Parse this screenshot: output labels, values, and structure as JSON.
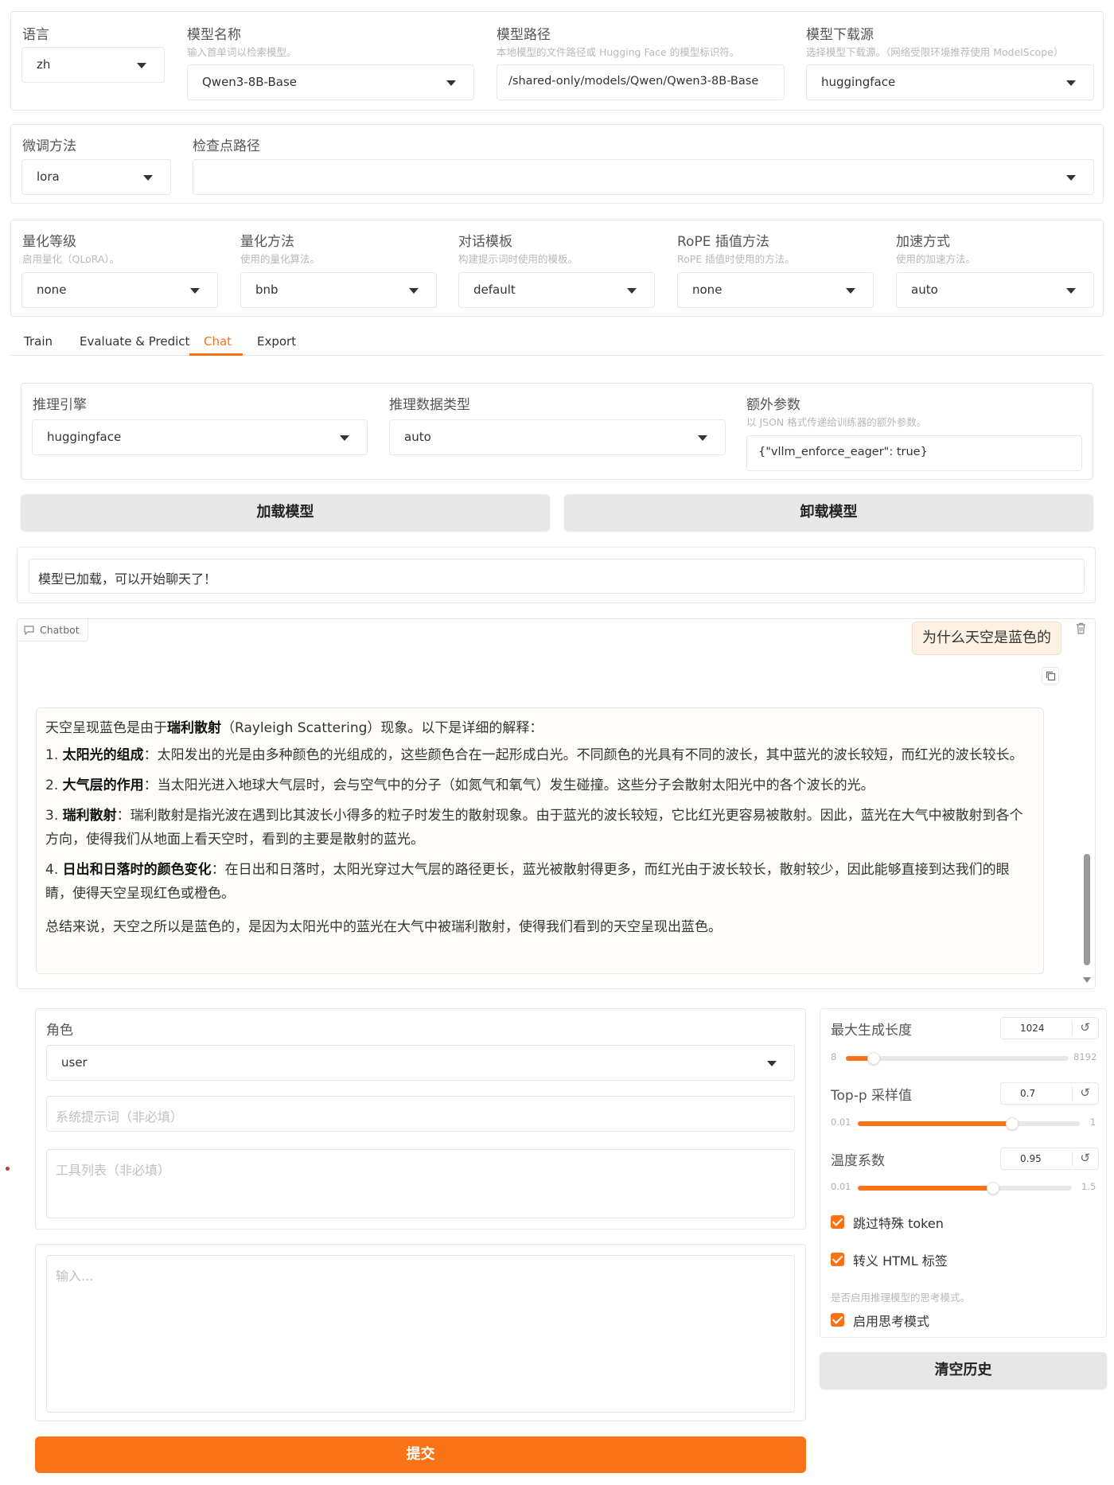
{
  "top": {
    "language": {
      "label": "语言",
      "value": "zh"
    },
    "model_name": {
      "label": "模型名称",
      "hint": "输入首单词以检索模型。",
      "value": "Qwen3-8B-Base"
    },
    "model_path": {
      "label": "模型路径",
      "hint": "本地模型的文件路径或 Hugging Face 的模型标识符。",
      "value": "/shared-only/models/Qwen/Qwen3-8B-Base"
    },
    "model_source": {
      "label": "模型下载源",
      "hint": "选择模型下载源。（网络受限环境推荐使用 ModelScope）",
      "value": "huggingface"
    }
  },
  "finetune": {
    "method": {
      "label": "微调方法",
      "value": "lora"
    },
    "checkpoint": {
      "label": "检查点路径",
      "value": ""
    }
  },
  "quant": {
    "level": {
      "label": "量化等级",
      "hint": "启用量化（QLoRA）。",
      "value": "none"
    },
    "method": {
      "label": "量化方法",
      "hint": "使用的量化算法。",
      "value": "bnb"
    },
    "template": {
      "label": "对话模板",
      "hint": "构建提示词时使用的模板。",
      "value": "default"
    },
    "rope": {
      "label": "RoPE 插值方法",
      "hint": "RoPE 插值时使用的方法。",
      "value": "none"
    },
    "booster": {
      "label": "加速方式",
      "hint": "使用的加速方法。",
      "value": "auto"
    }
  },
  "tabs": [
    "Train",
    "Evaluate & Predict",
    "Chat",
    "Export"
  ],
  "infer": {
    "backend": {
      "label": "推理引擎",
      "value": "huggingface"
    },
    "dtype": {
      "label": "推理数据类型",
      "value": "auto"
    },
    "extra": {
      "label": "额外参数",
      "hint": "以 JSON 格式传递给训练器的额外参数。",
      "value": "{\"vllm_enforce_eager\": true}"
    }
  },
  "buttons": {
    "load": "加载模型",
    "unload": "卸载模型",
    "submit": "提交",
    "clear": "清空历史"
  },
  "status": "模型已加载，可以开始聊天了！",
  "chatbot": {
    "label": "Chatbot",
    "user_msg": "为什么天空是蓝色的",
    "reply": {
      "intro_pre": "天空呈现蓝色是由于",
      "intro_bold": "瑞利散射",
      "intro_post": "（Rayleigh Scattering）现象。以下是详细的解释：",
      "items": [
        {
          "num": "1. ",
          "bold": "太阳光的组成",
          "text": "：太阳发出的光是由多种颜色的光组成的，这些颜色合在一起形成白光。不同颜色的光具有不同的波长，其中蓝光的波长较短，而红光的波长较长。"
        },
        {
          "num": "2. ",
          "bold": "大气层的作用",
          "text": "：当太阳光进入地球大气层时，会与空气中的分子（如氮气和氧气）发生碰撞。这些分子会散射太阳光中的各个波长的光。"
        },
        {
          "num": "3. ",
          "bold": "瑞利散射",
          "text": "：瑞利散射是指光波在遇到比其波长小得多的粒子时发生的散射现象。由于蓝光的波长较短，它比红光更容易被散射。因此，蓝光在大气中被散射到各个方向，使得我们从地面上看天空时，看到的主要是散射的蓝光。"
        },
        {
          "num": "4. ",
          "bold": "日出和日落时的颜色变化",
          "text": "：在日出和日落时，太阳光穿过大气层的路径更长，蓝光被散射得更多，而红光由于波长较长，散射较少，因此能够直接到达我们的眼睛，使得天空呈现红色或橙色。"
        }
      ],
      "summary": "总结来说，天空之所以是蓝色的，是因为太阳光中的蓝光在大气中被瑞利散射，使得我们看到的天空呈现出蓝色。"
    }
  },
  "role": {
    "label": "角色",
    "value": "user"
  },
  "system_placeholder": "系统提示词（非必填）",
  "tools_placeholder": "工具列表（非必填）",
  "input_placeholder": "输入...",
  "params": {
    "max_len": {
      "label": "最大生成长度",
      "value": "1024",
      "min": "8",
      "max": "8192",
      "fraction": 0.124
    },
    "top_p": {
      "label": "Top-p 采样值",
      "value": "0.7",
      "min": "0.01",
      "max": "1",
      "fraction": 0.697
    },
    "temp": {
      "label": "温度系数",
      "value": "0.95",
      "min": "0.01",
      "max": "1.5",
      "fraction": 0.631
    }
  },
  "checks": {
    "skip_special": "跳过特殊 token",
    "escape_html": "转义 HTML 标签",
    "think_hint": "是否启用推理模型的思考模式。",
    "think": "启用思考模式"
  },
  "colors": {
    "accent": "#f97316"
  }
}
